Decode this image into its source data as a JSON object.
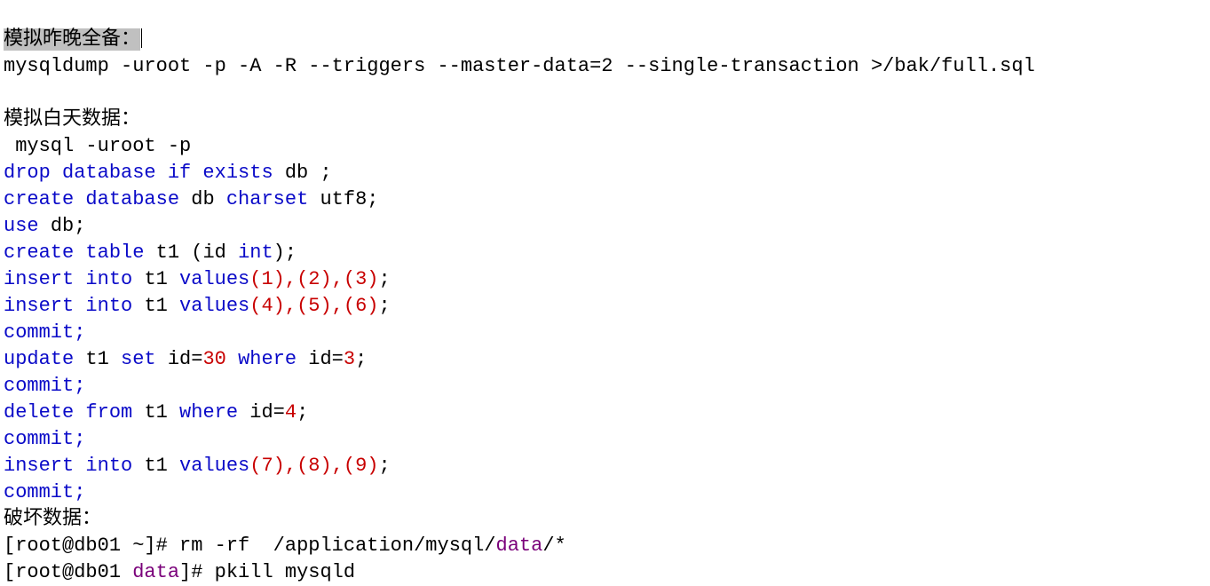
{
  "section1": {
    "title": "模拟昨晚全备：",
    "cmd": "mysqldump -uroot -p -A -R --triggers --master-data=2 --single-transaction >/bak/full.sql"
  },
  "section2": {
    "title": "模拟白天数据：",
    "login": " mysql -uroot -p",
    "sql": {
      "drop": {
        "kw1": "drop database if exists",
        "id": "db",
        "t": " ;"
      },
      "create": {
        "kw1": "create database",
        "id": "db",
        "kw2": "charset",
        "arg": "utf8;"
      },
      "use": {
        "kw1": "use",
        "id": "db;"
      },
      "table": {
        "kw1": "create table",
        "id": "t1",
        "p": "(id ",
        "ty": "int",
        "p2": ");"
      },
      "ins1": {
        "kw1": "insert into",
        "id": "t1",
        "kw2": "values",
        "vals": "(1),(2),(3)",
        "t": ";"
      },
      "ins2": {
        "kw1": "insert into",
        "id": "t1",
        "kw2": "values",
        "vals": "(4),(5),(6)",
        "t": ";"
      },
      "commit1": "commit;",
      "upd": {
        "kw1": "update",
        "id": "t1",
        "kw2": "set",
        "a": "id=",
        "n1": "30",
        "kw3": "where",
        "b": "id=",
        "n2": "3",
        "t": ";"
      },
      "commit2": "commit;",
      "del": {
        "kw1": "delete from",
        "id": "t1",
        "kw2": "where",
        "a": "id=",
        "n": "4",
        "t": ";"
      },
      "commit3": "commit;",
      "ins3": {
        "kw1": "insert into",
        "id": "t1",
        "kw2": "values",
        "vals": "(7),(8),(9)",
        "t": ";"
      },
      "commit4": "commit;"
    }
  },
  "section3": {
    "title": "破坏数据：",
    "line1": {
      "p1": "[root@db01 ~]# ",
      "cmd": "rm -rf  /application/mysql/",
      "tail": "data",
      "star": "/*"
    },
    "line2": {
      "p1": "[root@db01 ",
      "dir": "data",
      "p2": "]# ",
      "cmd": "pkill mysqld"
    }
  }
}
